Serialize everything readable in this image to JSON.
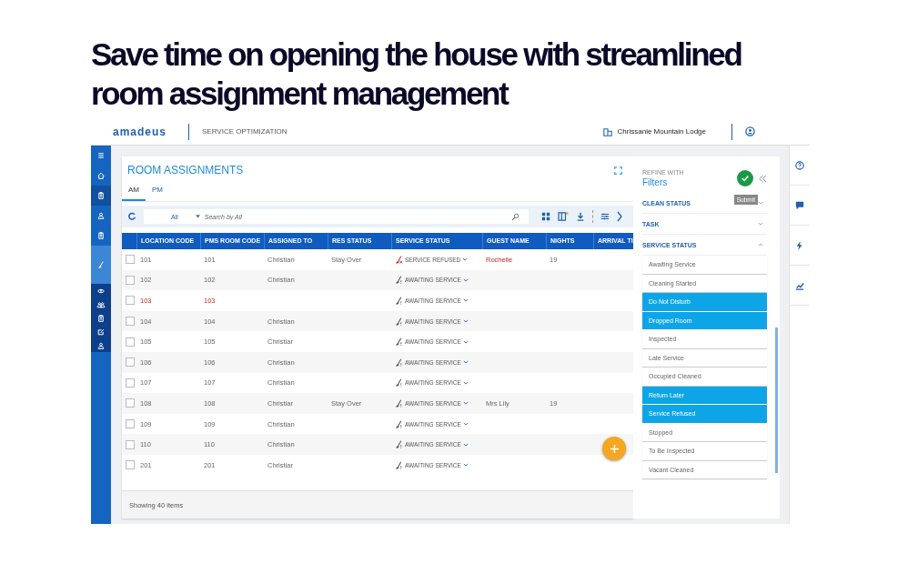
{
  "heading": "Save time on opening the house with streamlined room assignment management",
  "app": {
    "logo": "amadeus",
    "product": "SERVICE OPTIMIZATION",
    "property": "Chrissanie Mountain Lodge"
  },
  "nav": [
    {
      "kind": "menu",
      "selected": false
    },
    {
      "kind": "home",
      "selected": false
    },
    {
      "kind": "clipboard",
      "selected": false
    },
    {
      "kind": "person",
      "selected": false
    },
    {
      "kind": "clipboard",
      "selected": false
    },
    {
      "kind": "broom",
      "selected": true
    },
    {
      "kind": "eye",
      "selected": false
    },
    {
      "kind": "people",
      "selected": false
    },
    {
      "kind": "clipboard",
      "selected": false
    },
    {
      "kind": "edit",
      "selected": false
    },
    {
      "kind": "person",
      "selected": false
    }
  ],
  "page": {
    "title": "ROOM ASSIGNMENTS",
    "tabs": [
      {
        "label": "AM",
        "selected": true
      },
      {
        "label": "PM",
        "selected": false
      }
    ],
    "filter_scope": "All",
    "search": {
      "placeholder": "Search by All"
    }
  },
  "table": {
    "columns": [
      "LOCATION CODE",
      "PMS ROOM CODE",
      "ASSIGNED TO",
      "RES STATUS",
      "SERVICE STATUS",
      "GUEST NAME",
      "NIGHTS",
      "ARRIVAL TI"
    ],
    "rows": [
      {
        "kind": "refused",
        "checked": false,
        "location": "101",
        "pms": "101",
        "assigned": "Christian",
        "res_status": "Stay Over",
        "service": "SERVICE REFUSED",
        "guest": "Rochelle",
        "guest_flagged": true,
        "nights": "19",
        "flagged": false
      },
      {
        "kind": "awaiting",
        "checked": false,
        "location": "102",
        "pms": "102",
        "assigned": "Christian",
        "service": "AWAITING SERVICE",
        "flagged": false
      },
      {
        "kind": "awaiting",
        "checked": false,
        "location": "103",
        "pms": "103",
        "service": "AWAITING SERVICE",
        "flagged": true
      },
      {
        "kind": "awaiting",
        "checked": false,
        "location": "104",
        "pms": "104",
        "assigned": "Christian",
        "service": "AWAITING SERVICE",
        "flagged": false
      },
      {
        "kind": "awaiting",
        "checked": false,
        "location": "105",
        "pms": "105",
        "assigned": "Christiar",
        "service": "AWAITING SERVICE",
        "flagged": false
      },
      {
        "kind": "awaiting",
        "checked": false,
        "location": "106",
        "pms": "106",
        "assigned": "Christian",
        "service": "AWAITING SERVICE",
        "flagged": false
      },
      {
        "kind": "awaiting",
        "checked": false,
        "location": "107",
        "pms": "107",
        "assigned": "Christian",
        "service": "AWAITING SERVICE",
        "flagged": false
      },
      {
        "kind": "awaiting",
        "checked": false,
        "location": "108",
        "pms": "108",
        "assigned": "Christiar",
        "res_status": "Stay Over",
        "service": "AWAITING SERVICE",
        "guest": "Mrs Lily",
        "guest_flagged": false,
        "nights": "19",
        "flagged": false
      },
      {
        "kind": "awaiting",
        "checked": false,
        "location": "109",
        "pms": "109",
        "assigned": "Christian",
        "service": "AWAITING SERVICE",
        "flagged": false
      },
      {
        "kind": "awaiting",
        "checked": false,
        "location": "110",
        "pms": "110",
        "assigned": "Christian",
        "service": "AWAITING SERVICE",
        "flagged": false
      },
      {
        "kind": "awaiting",
        "checked": false,
        "location": "201",
        "pms": "201",
        "assigned": "Christiar",
        "service": "AWAITING SERVICE",
        "flagged": false
      }
    ],
    "footer": "Showing 40 items"
  },
  "filters": {
    "eyebrow": "REFINE WITH",
    "title": "Filters",
    "submit_tooltip": "Submit",
    "sections": [
      {
        "title": "CLEAN STATUS",
        "expanded": false
      },
      {
        "title": "TASK",
        "expanded": false
      },
      {
        "title": "SERVICE STATUS",
        "expanded": true,
        "options": [
          {
            "label": "Awaiting Service",
            "selected": false
          },
          {
            "label": "Cleaning Started",
            "selected": false
          },
          {
            "label": "Do Not Disturb",
            "selected": true
          },
          {
            "label": "Dropped Room",
            "selected": true
          },
          {
            "label": "Inspected",
            "selected": false
          },
          {
            "label": "Late Service",
            "selected": false
          },
          {
            "label": "Occupied Cleaned",
            "selected": false
          },
          {
            "label": "Return Later",
            "selected": true
          },
          {
            "label": "Service Refused",
            "selected": true
          },
          {
            "label": "Stopped",
            "selected": false
          },
          {
            "label": "To Be Inspected",
            "selected": false
          },
          {
            "label": "Vacant Cleaned",
            "selected": false
          }
        ]
      }
    ]
  }
}
